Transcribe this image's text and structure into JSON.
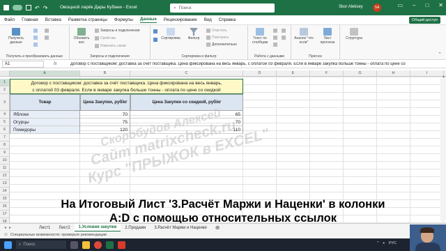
{
  "window": {
    "title": "Овощной ларёк Дары Кубани - Excel",
    "search_placeholder": "Поиск",
    "user_name": "Skor Aleksey",
    "user_initials": "SA",
    "share_label": "Общий доступ"
  },
  "menu_tabs": [
    "Файл",
    "Главная",
    "Вставка",
    "Разметка страницы",
    "Формулы",
    "Данные",
    "Рецензирование",
    "Вид",
    "Справка"
  ],
  "active_tab": "Данные",
  "ribbon": {
    "get_data": "Получить данные",
    "refresh_all": "Обновить все",
    "queries_connections": "Запросы и подключения",
    "properties": "Свойства",
    "edit_links": "Изменить связи",
    "sort": "Сортировка",
    "filter": "Фильтр",
    "clear": "Очистить",
    "reapply": "Повторить",
    "advanced": "Дополнительно",
    "text_to_columns": "Текст по столбцам",
    "whatif": "Анализ \"что если\"",
    "forecast_sheet": "Лист прогноза",
    "outline": "Структура",
    "group_get": "Получить и преобразовать данные",
    "group_queries": "Запросы и подключения",
    "group_sort": "Сортировка и фильтр",
    "group_data_tools": "Работа с данными",
    "group_forecast": "Прогноз"
  },
  "formula_bar": {
    "name_box": "A1",
    "fx": "fx",
    "content": "Договор с поставщиком: доставка за счёт поставщика. Цена фиксирована на весь январь, с оплатой 03 февраля. Если в январе закупка больше тонны - оплата по цене со"
  },
  "columns": [
    "A",
    "B",
    "C",
    "D",
    "E",
    "F",
    "G",
    "H",
    "I",
    "J",
    "K"
  ],
  "rows": [
    "1",
    "2",
    "3",
    "4",
    "5",
    "6",
    "7",
    "8",
    "9",
    "10",
    "11",
    "12",
    "13",
    "14",
    "15",
    "16",
    "17",
    "18",
    "19"
  ],
  "note": {
    "line1": "Договор с поставщиком: доставка за счёт поставщика. Цена фиксирована на весь январь,",
    "line2": "с оплатой 03 февраля. Если в январе закупка больше тонны - оплата по цене со скидкой"
  },
  "table": {
    "headers": [
      "Товар",
      "Цена Закупки, руб/кг",
      "Цена Закупки со скидкой, руб/кг"
    ],
    "rows": [
      {
        "item": "Яблоки",
        "price": "70",
        "discount": "65"
      },
      {
        "item": "Огурцы",
        "price": "75",
        "discount": "70"
      },
      {
        "item": "Помидоры",
        "price": "120",
        "discount": "110"
      }
    ]
  },
  "watermark": {
    "line1": "Скоробудов Алексей",
    "line2": "Сайт matrixcheck.ru",
    "line3": "Курс \"ПРЫЖОК в EXCEL\""
  },
  "caption": {
    "line1": "На Итоговый Лист '3.Расчёт Маржи и Наценки' в колонки",
    "line2": "A:D с помощью относительных ссылок"
  },
  "sheet_tabs": [
    "Лист1",
    "Лист2",
    "1.Условия закупки",
    "2.Продажи",
    "3.Расчёт Маржи и Наценки"
  ],
  "active_sheet": "1.Условия закупки",
  "status_text": "Специальные возможности: проверьте рекомендации",
  "taskbar": {
    "search": "Поиск",
    "lang": "РУС"
  },
  "colors": {
    "excel_green": "#1e7145",
    "header_fill": "#dce6f2",
    "note_fill": "#fff9c7"
  }
}
